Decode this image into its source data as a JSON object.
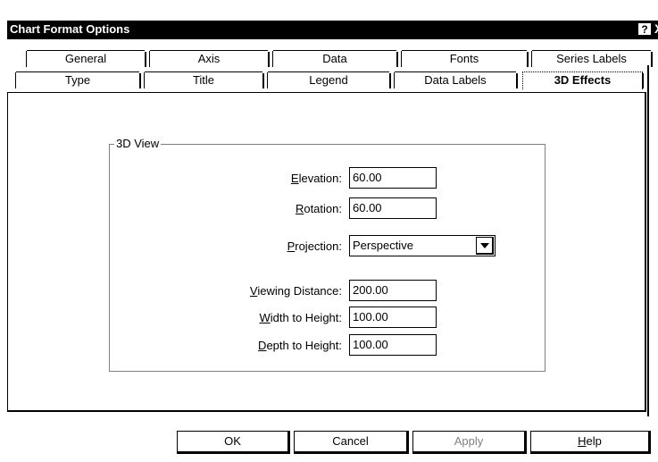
{
  "window": {
    "title": "Chart Format Options",
    "help_glyph": "?",
    "close_glyph": "X"
  },
  "tabs": {
    "back_row": [
      "General",
      "Axis",
      "Data",
      "Fonts",
      "Series Labels"
    ],
    "front_row": [
      "Type",
      "Title",
      "Legend",
      "Data Labels",
      "3D Effects"
    ],
    "active": "3D Effects"
  },
  "group": {
    "label": "3D View"
  },
  "fields": {
    "elevation": {
      "label_accel": "E",
      "label_rest": "levation:",
      "value": "60.00"
    },
    "rotation": {
      "label_accel": "R",
      "label_rest": "otation:",
      "value": "60.00"
    },
    "projection": {
      "label_accel": "P",
      "label_rest": "rojection:",
      "value": "Perspective"
    },
    "viewing_distance": {
      "label_accel": "V",
      "label_rest": "iewing Distance:",
      "value": "200.00"
    },
    "width_to_height": {
      "label_accel": "W",
      "label_rest": "idth to Height:",
      "value": "100.00"
    },
    "depth_to_height": {
      "label_accel": "D",
      "label_rest": "epth to Height:",
      "value": "100.00"
    }
  },
  "buttons": {
    "ok": "OK",
    "cancel": "Cancel",
    "apply": "Apply",
    "help_accel": "H",
    "help_rest": "elp"
  }
}
